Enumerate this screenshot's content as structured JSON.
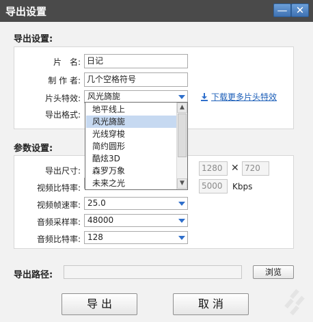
{
  "window": {
    "title": "导出设置",
    "minimize_label": "—",
    "close_label": "✕"
  },
  "export_settings": {
    "section_title": "导出设置:",
    "name_label": "片　名:",
    "name_value": "日记",
    "author_label": "制 作 者:",
    "author_value": "几个空格符号",
    "intro_effect_label": "片头特效:",
    "intro_effect_value": "风光旖旎",
    "download_link": "下载更多片头特效",
    "format_label": "导出格式:",
    "effect_options": [
      "地平线上",
      "风光旖旎",
      "光线穿梭",
      "简约圆形",
      "酷炫3D",
      "森罗万象",
      "未来之光"
    ],
    "effect_selected_index": 1
  },
  "params": {
    "section_title": "参数设置:",
    "size_label": "导出尺寸:",
    "width_value": "1280",
    "times": "✕",
    "height_value": "720",
    "video_bitrate_label": "视频比特率:",
    "video_bitrate_custom": "5000",
    "bitrate_unit": "Kbps",
    "framerate_label": "视频帧速率:",
    "framerate_value": "25.0",
    "samplerate_label": "音频采样率:",
    "samplerate_value": "48000",
    "audio_bitrate_label": "音频比特率:",
    "audio_bitrate_value": "128"
  },
  "path": {
    "label": "导出路径:",
    "value": "",
    "browse_label": "浏览"
  },
  "actions": {
    "export_label": "导 出",
    "cancel_label": "取 消"
  },
  "colors": {
    "accent": "#2f6fcb",
    "titlebar": "#4a4a4a",
    "selection": "#c6d9f1"
  }
}
